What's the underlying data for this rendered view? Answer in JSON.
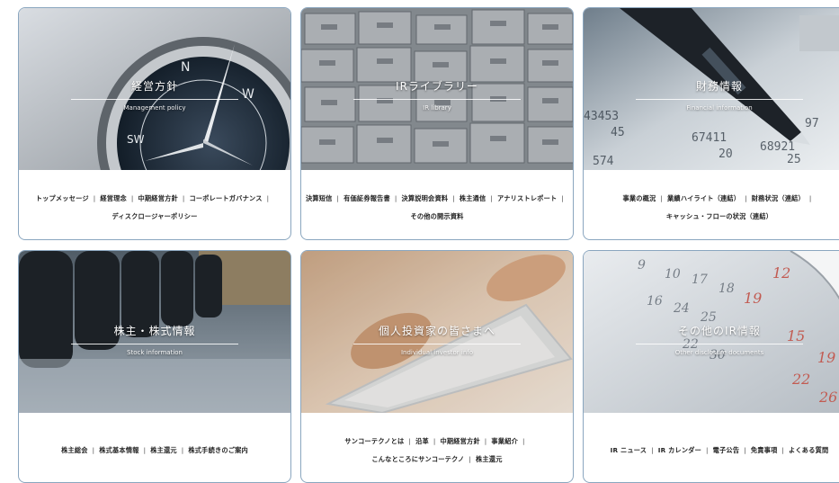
{
  "cards": [
    {
      "title": "経営方針",
      "subtitle": "Management policy",
      "image_icon": "compass-image",
      "rows": [
        [
          "トップメッセージ",
          "経営理念",
          "中期経営方針",
          "コーポレートガバナンス"
        ],
        [
          "ディスクロージャーポリシー"
        ]
      ]
    },
    {
      "title": "IRライブラリー",
      "subtitle": "IR library",
      "image_icon": "file-cabinet-image",
      "rows": [
        [
          "決算短信",
          "有価証券報告書",
          "決算説明会資料",
          "株主通信",
          "アナリストレポート"
        ],
        [
          "その他の開示資料"
        ]
      ]
    },
    {
      "title": "財務情報",
      "subtitle": "Financial information",
      "image_icon": "pen-and-figures-image",
      "rows": [
        [
          "事業の概況",
          "業績ハイライト（連結）",
          "財務状況（連結）"
        ],
        [
          "キャッシュ・フローの状況（連結）"
        ]
      ]
    },
    {
      "title": "株主・株式情報",
      "subtitle": "Stock information",
      "image_icon": "binders-image",
      "rows": [
        [
          "株主総会",
          "株式基本情報",
          "株主還元",
          "株式手続きのご案内"
        ]
      ]
    },
    {
      "title": "個人投資家の皆さまへ",
      "subtitle": "Individual investor info",
      "image_icon": "tablet-image",
      "rows": [
        [
          "サンコーテクノとは",
          "沿革",
          "中期経営方針",
          "事業紹介"
        ],
        [
          "こんなところにサンコーテクノ",
          "株主還元"
        ]
      ]
    },
    {
      "title": "その他のIR情報",
      "subtitle": "Other disclosure documents",
      "image_icon": "calendar-image",
      "rows": [
        [
          "IR ニュース",
          "IR カレンダー",
          "電子公告",
          "免責事項",
          "よくある質問"
        ]
      ]
    }
  ],
  "trailing_separator_rows": [
    "0.0",
    "1.0",
    "2.0"
  ]
}
